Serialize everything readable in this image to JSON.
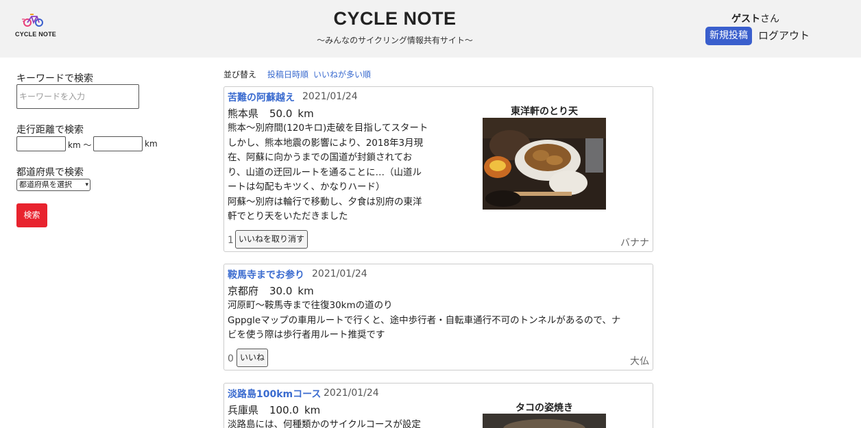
{
  "header": {
    "logo_text": "CYCLE NOTE",
    "title": "CYCLE NOTE",
    "subtitle": "〜みんなのサイクリング情報共有サイト〜",
    "guest_name": "ゲスト",
    "guest_suffix": "さん",
    "new_post_label": "新規投稿",
    "logout_label": "ログアウト",
    "accent_color": "#3a5fcd"
  },
  "sidebar": {
    "keyword_label": "キーワードで検索",
    "keyword_placeholder": "キーワードを入力",
    "distance_label": "走行距離で検索",
    "distance_unit_mid": "km 〜",
    "distance_unit_end": "km",
    "prefecture_label": "都道府県で検索",
    "prefecture_selected": "都道府県を選択",
    "search_button": "検索",
    "search_button_color": "#e8232e"
  },
  "sort": {
    "label": "並び替え",
    "options": [
      "投稿日時順",
      "いいねが多い順"
    ]
  },
  "posts": [
    {
      "title": "苦難の阿蘇越え",
      "date": "2021/01/24",
      "prefecture": "熊本県",
      "distance": "50.0",
      "unit": "km",
      "body": "熊本〜別府間(120キロ)走破を目指してスタート\nしかし、熊本地震の影響により、2018年3月現\n在、阿蘇に向かうまでの国道が封鎖されてお\nり、山道の迂回ルートを通ることに…（山道ル\nートは勾配もキツく、かなりハード）\n阿蘇〜別府は輪行で移動し、夕食は別府の東洋\n軒でとり天をいただきました",
      "like_count": "1",
      "like_button": "いいねを取り消す",
      "author": "バナナ",
      "image_caption": "東洋軒のとり天"
    },
    {
      "title": "鞍馬寺までお参り",
      "date": "2021/01/24",
      "prefecture": "京都府",
      "distance": "30.0",
      "unit": "km",
      "body": "河原町〜鞍馬寺まで往復30kmの道のり\nGppgleマップの車用ルートで行くと、途中歩行者・自転車通行不可のトンネルがあるので、ナ\nビを使う際は歩行者用ルート推奨です",
      "like_count": "0",
      "like_button": "いいね",
      "author": "大仏"
    },
    {
      "title": "淡路島100kmコース",
      "date": "2021/01/24",
      "prefecture": "兵庫県",
      "distance": "100.0",
      "unit": "km",
      "body": "淡路島には、何種類かのサイクルコースが設定",
      "image_caption": "タコの姿焼き"
    }
  ]
}
